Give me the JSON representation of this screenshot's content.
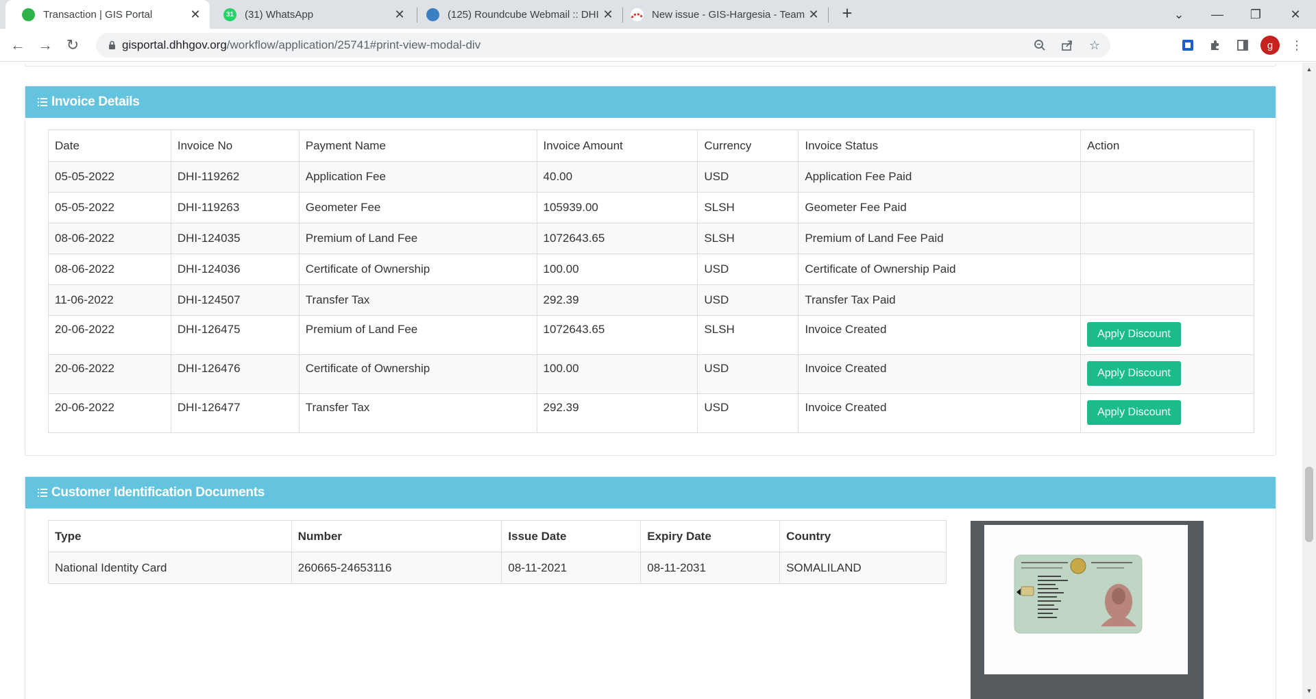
{
  "browser": {
    "tabs": [
      {
        "title": "Transaction | GIS Portal",
        "active": true
      },
      {
        "title": "(31) WhatsApp",
        "badge": "31"
      },
      {
        "title": "(125) Roundcube Webmail :: DHI"
      },
      {
        "title": "New issue - GIS-Hargesia - Team"
      }
    ],
    "url_host": "gisportal.dhhgov.org",
    "url_path": "/workflow/application/25741#print-view-modal-div",
    "profile_initial": "g"
  },
  "invoice": {
    "heading": "Invoice Details",
    "columns": [
      "Date",
      "Invoice No",
      "Payment Name",
      "Invoice Amount",
      "Currency",
      "Invoice Status",
      "Action"
    ],
    "rows": [
      {
        "date": "05-05-2022",
        "no": "DHI-119262",
        "name": "Application Fee",
        "amount": "40.00",
        "currency": "USD",
        "status": "Application Fee Paid",
        "action": ""
      },
      {
        "date": "05-05-2022",
        "no": "DHI-119263",
        "name": "Geometer Fee",
        "amount": "105939.00",
        "currency": "SLSH",
        "status": "Geometer Fee Paid",
        "action": ""
      },
      {
        "date": "08-06-2022",
        "no": "DHI-124035",
        "name": "Premium of Land Fee",
        "amount": "1072643.65",
        "currency": "SLSH",
        "status": "Premium of Land Fee Paid",
        "action": ""
      },
      {
        "date": "08-06-2022",
        "no": "DHI-124036",
        "name": "Certificate of Ownership",
        "amount": "100.00",
        "currency": "USD",
        "status": "Certificate of Ownership Paid",
        "action": ""
      },
      {
        "date": "11-06-2022",
        "no": "DHI-124507",
        "name": "Transfer Tax",
        "amount": "292.39",
        "currency": "USD",
        "status": "Transfer Tax Paid",
        "action": ""
      },
      {
        "date": "20-06-2022",
        "no": "DHI-126475",
        "name": "Premium of Land Fee",
        "amount": "1072643.65",
        "currency": "SLSH",
        "status": "Invoice Created",
        "action": "Apply Discount"
      },
      {
        "date": "20-06-2022",
        "no": "DHI-126476",
        "name": "Certificate of Ownership",
        "amount": "100.00",
        "currency": "USD",
        "status": "Invoice Created",
        "action": "Apply Discount"
      },
      {
        "date": "20-06-2022",
        "no": "DHI-126477",
        "name": "Transfer Tax",
        "amount": "292.39",
        "currency": "USD",
        "status": "Invoice Created",
        "action": "Apply Discount"
      }
    ]
  },
  "documents": {
    "heading": "Customer Identification Documents",
    "columns": [
      "Type",
      "Number",
      "Issue Date",
      "Expiry Date",
      "Country"
    ],
    "rows": [
      {
        "type": "National Identity Card",
        "number": "260665-24653116",
        "issue": "08-11-2021",
        "expiry": "08-11-2031",
        "country": "SOMALILAND"
      }
    ]
  },
  "colors": {
    "panel_header": "#64c3df",
    "button": "#19bc8a"
  }
}
